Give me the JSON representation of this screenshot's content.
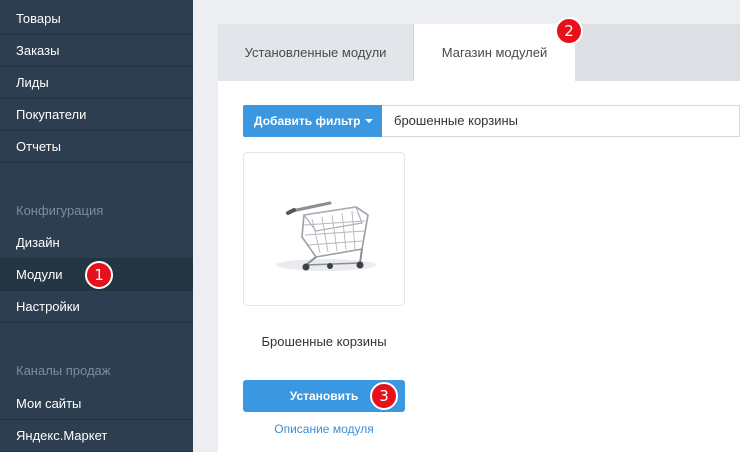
{
  "sidebar": {
    "items": [
      {
        "label": "Товары"
      },
      {
        "label": "Заказы"
      },
      {
        "label": "Лиды"
      },
      {
        "label": "Покупатели"
      },
      {
        "label": "Отчеты"
      }
    ],
    "section_config": "Конфигурация",
    "config_items": [
      {
        "label": "Дизайн"
      },
      {
        "label": "Модули"
      },
      {
        "label": "Настройки"
      }
    ],
    "section_channels": "Каналы продаж",
    "channel_items": [
      {
        "label": "Мои сайты"
      },
      {
        "label": "Яндекс.Маркет"
      }
    ]
  },
  "tabs": [
    {
      "label": "Установленные модули"
    },
    {
      "label": "Магазин модулей"
    }
  ],
  "filter": {
    "button_label": "Добавить фильтр",
    "value": "брошенные корзины"
  },
  "module": {
    "title": "Брошенные корзины",
    "install_label": "Установить",
    "description_link": "Описание модуля"
  },
  "annotations": {
    "step1": "1",
    "step2": "2",
    "step3": "3"
  },
  "colors": {
    "sidebar_bg": "#2c3e50",
    "accent": "#3a97e0",
    "badge": "#e8101a"
  }
}
